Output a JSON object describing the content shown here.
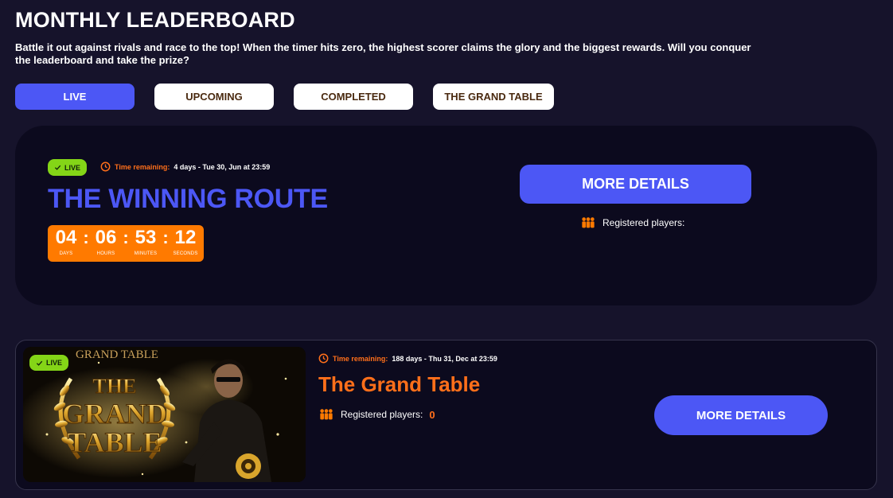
{
  "header": {
    "title": "MONTHLY LEADERBOARD",
    "description": "Battle it out against rivals and race to the top! When the timer hits zero, the highest scorer claims the glory and the biggest rewards. Will you conquer the leaderboard and take the prize?"
  },
  "tabs": [
    {
      "label": "LIVE",
      "active": true
    },
    {
      "label": "UPCOMING",
      "active": false
    },
    {
      "label": "COMPLETED",
      "active": false
    },
    {
      "label": "THE GRAND TABLE",
      "active": false
    }
  ],
  "events": [
    {
      "badge": "LIVE",
      "time_label": "Time remaining:",
      "time_value": "4 days - Tue 30, Jun at 23:59",
      "title": "THE WINNING ROUTE",
      "countdown": [
        {
          "value": "04",
          "unit": "DAYS"
        },
        {
          "value": "06",
          "unit": "HOURS"
        },
        {
          "value": "53",
          "unit": "MINUTES"
        },
        {
          "value": "12",
          "unit": "SECONDS"
        }
      ],
      "button_label": "MORE DETAILS",
      "registered_label": "Registered players:"
    },
    {
      "badge": "LIVE",
      "time_label": "Time remaining:",
      "time_value": "188 days - Thu 31, Dec at 23:59",
      "title": "The Grand Table",
      "registered_label": "Registered players:",
      "registered_count": "0",
      "button_label": "MORE DETAILS",
      "image_text": {
        "banner": "GRAND TABLE",
        "line1": "THE",
        "line2": "GRAND",
        "line3": "TABLE"
      }
    }
  ],
  "colors": {
    "background": "#16132b",
    "card": "#0c0a1e",
    "accent_blue": "#4c57f5",
    "accent_orange": "#ff7a00",
    "live_green": "#84d517"
  }
}
